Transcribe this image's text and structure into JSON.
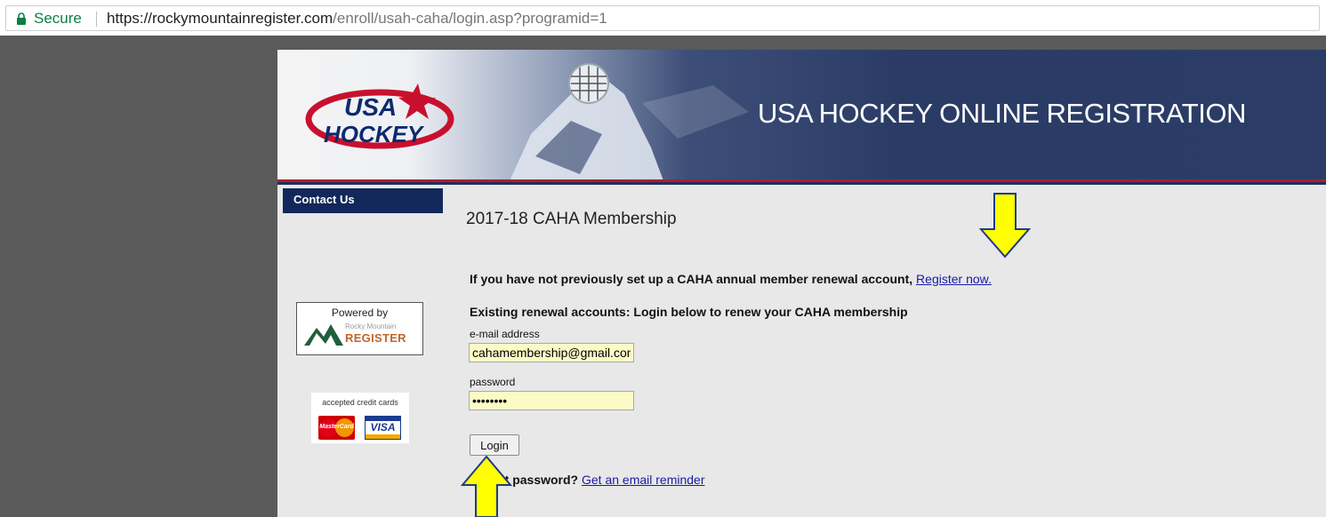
{
  "browser": {
    "secure_label": "Secure",
    "url_host": "https://rockymountainregister.com",
    "url_path": "/enroll/usah-caha/login.asp?programid=1"
  },
  "banner": {
    "title": "USA HOCKEY ONLINE REGISTRATION",
    "logo_text_top": "USA",
    "logo_text_bottom": "HOCKEY"
  },
  "sidebar": {
    "contact_label": "Contact Us",
    "powered_by": "Powered by",
    "rmr_small": "Rocky Mountain",
    "rmr_large": "REGISTER",
    "cards_label": "accepted credit cards",
    "mastercard_label": "MasterCard",
    "visa_label": "VISA"
  },
  "main": {
    "heading": "2017-18 CAHA Membership",
    "register_prompt": "If you have not previously set up a CAHA annual member renewal account, ",
    "register_link": "Register now.",
    "existing_prompt": "Existing renewal accounts: Login below to renew your CAHA membership",
    "email_label": "e-mail address",
    "email_value": "cahamembership@gmail.com",
    "password_label": "password",
    "password_value": "password",
    "login_button": "Login",
    "forgot_prompt": "Forgot password? ",
    "forgot_link": "Get an email reminder"
  },
  "colors": {
    "nav_blue": "#12285a",
    "field_bg": "#fbfbc6",
    "arrow_yellow": "#ffff00",
    "link": "#1a1aa6"
  }
}
